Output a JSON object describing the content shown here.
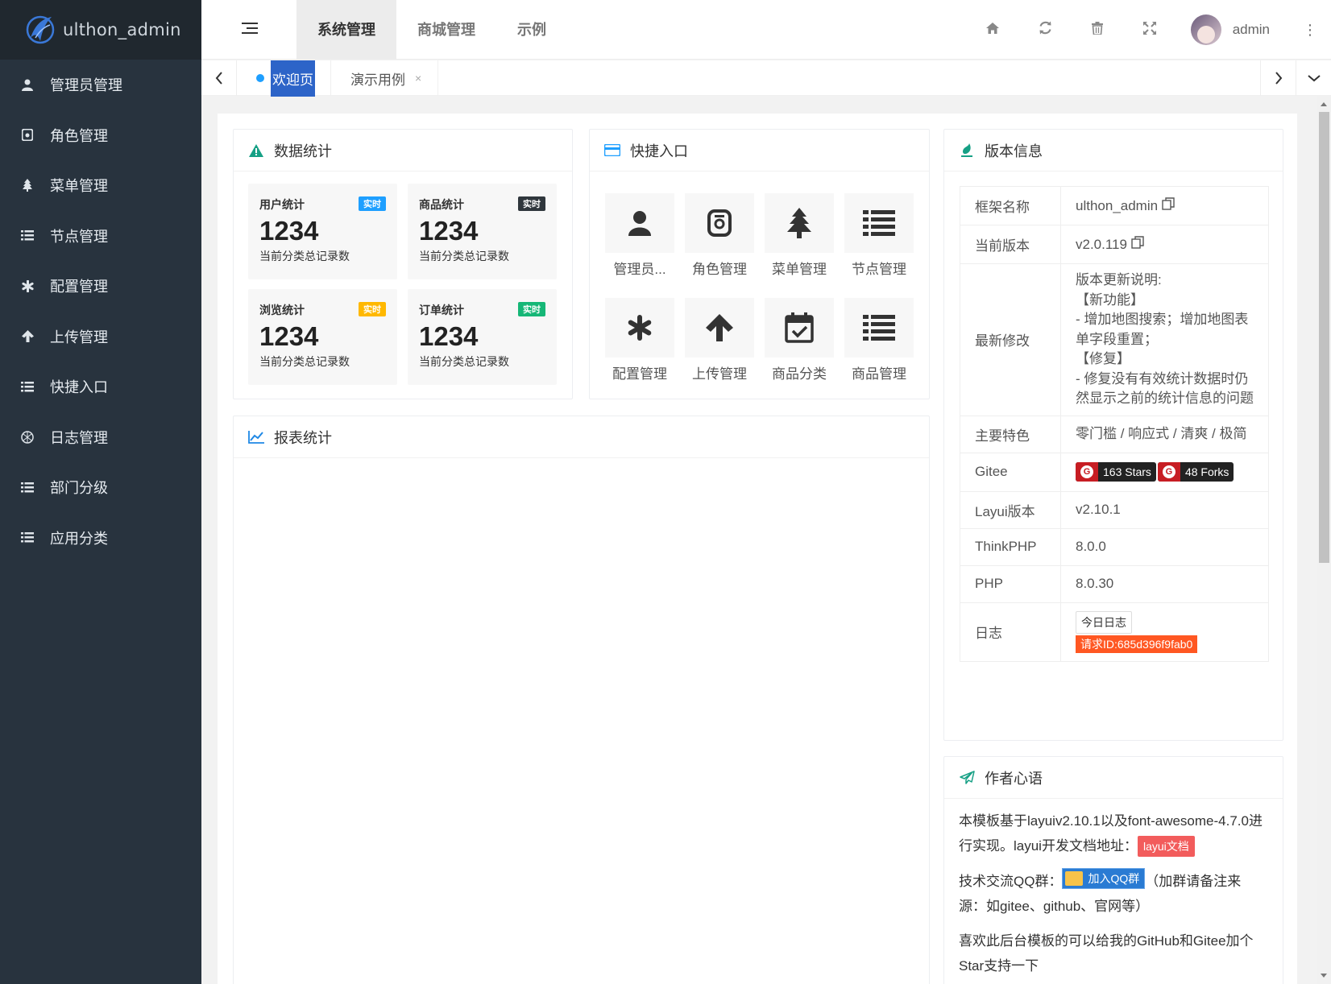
{
  "app": {
    "name": "ulthon_admin"
  },
  "sidebar": {
    "items": [
      {
        "label": "管理员管理",
        "icon": "user-icon"
      },
      {
        "label": "角色管理",
        "icon": "role-icon"
      },
      {
        "label": "菜单管理",
        "icon": "tree-icon"
      },
      {
        "label": "节点管理",
        "icon": "list-icon"
      },
      {
        "label": "配置管理",
        "icon": "asterisk-icon"
      },
      {
        "label": "上传管理",
        "icon": "arrow-up-icon"
      },
      {
        "label": "快捷入口",
        "icon": "list-icon"
      },
      {
        "label": "日志管理",
        "icon": "globe-icon"
      },
      {
        "label": "部门分级",
        "icon": "list-icon"
      },
      {
        "label": "应用分类",
        "icon": "list-icon"
      }
    ]
  },
  "header": {
    "nav": [
      "系统管理",
      "商城管理",
      "示例"
    ],
    "active_nav": "系统管理",
    "user": "admin"
  },
  "tabs": {
    "welcome": "欢迎页",
    "demo": "演示用例",
    "close": "×"
  },
  "stats": {
    "title": "数据统计",
    "items": [
      {
        "title": "用户统计",
        "badge": "实时",
        "badge_color": "#1e9fff",
        "value": "1234",
        "desc": "当前分类总记录数"
      },
      {
        "title": "商品统计",
        "badge": "实时",
        "badge_color": "#2f363c",
        "value": "1234",
        "desc": "当前分类总记录数"
      },
      {
        "title": "浏览统计",
        "badge": "实时",
        "badge_color": "#ffb800",
        "value": "1234",
        "desc": "当前分类总记录数"
      },
      {
        "title": "订单统计",
        "badge": "实时",
        "badge_color": "#16b777",
        "value": "1234",
        "desc": "当前分类总记录数"
      }
    ]
  },
  "shortcuts": {
    "title": "快捷入口",
    "items": [
      {
        "label": "管理员...",
        "icon": "user-icon"
      },
      {
        "label": "角色管理",
        "icon": "role-icon"
      },
      {
        "label": "菜单管理",
        "icon": "tree-icon"
      },
      {
        "label": "节点管理",
        "icon": "list-icon"
      },
      {
        "label": "配置管理",
        "icon": "asterisk-icon"
      },
      {
        "label": "上传管理",
        "icon": "arrow-up-icon"
      },
      {
        "label": "商品分类",
        "icon": "calendar-check-icon"
      },
      {
        "label": "商品管理",
        "icon": "list-icon"
      }
    ]
  },
  "report": {
    "title": "报表统计"
  },
  "version": {
    "title": "版本信息",
    "rows": {
      "framework": {
        "key": "框架名称",
        "value": "ulthon_admin"
      },
      "current": {
        "key": "当前版本",
        "value": "v2.0.119"
      },
      "latest": {
        "key": "最新修改",
        "lines": [
          "版本更新说明:",
          "【新功能】",
          "- 增加地图搜索；增加地图表单字段重置；",
          "【修复】",
          "- 修复没有有效统计数据时仍然显示之前的统计信息的问题"
        ]
      },
      "features": {
        "key": "主要特色",
        "value": "零门槛 / 响应式 / 清爽 / 极简"
      },
      "gitee": {
        "key": "Gitee",
        "stars": "163 Stars",
        "forks": "48 Forks"
      },
      "layui": {
        "key": "Layui版本",
        "value": "v2.10.1"
      },
      "thinkphp": {
        "key": "ThinkPHP",
        "value": "8.0.0"
      },
      "php": {
        "key": "PHP",
        "value": "8.0.30"
      },
      "log": {
        "key": "日志",
        "button": "今日日志",
        "request_id": "请求ID:685d396f9fab0"
      }
    }
  },
  "author": {
    "title": "作者心语",
    "p1_text": "本模板基于layuiv2.10.1以及font-awesome-4.7.0进行实现。layui开发文档地址：",
    "p1_tag": "layui文档",
    "p2_prefix": "技术交流QQ群：",
    "p2_tag": "加入QQ群",
    "p2_suffix": "（加群请备注来源：如gitee、github、官网等）",
    "p3_text": "喜欢此后台模板的可以给我的GitHub和Gitee加个Star支持一下"
  }
}
